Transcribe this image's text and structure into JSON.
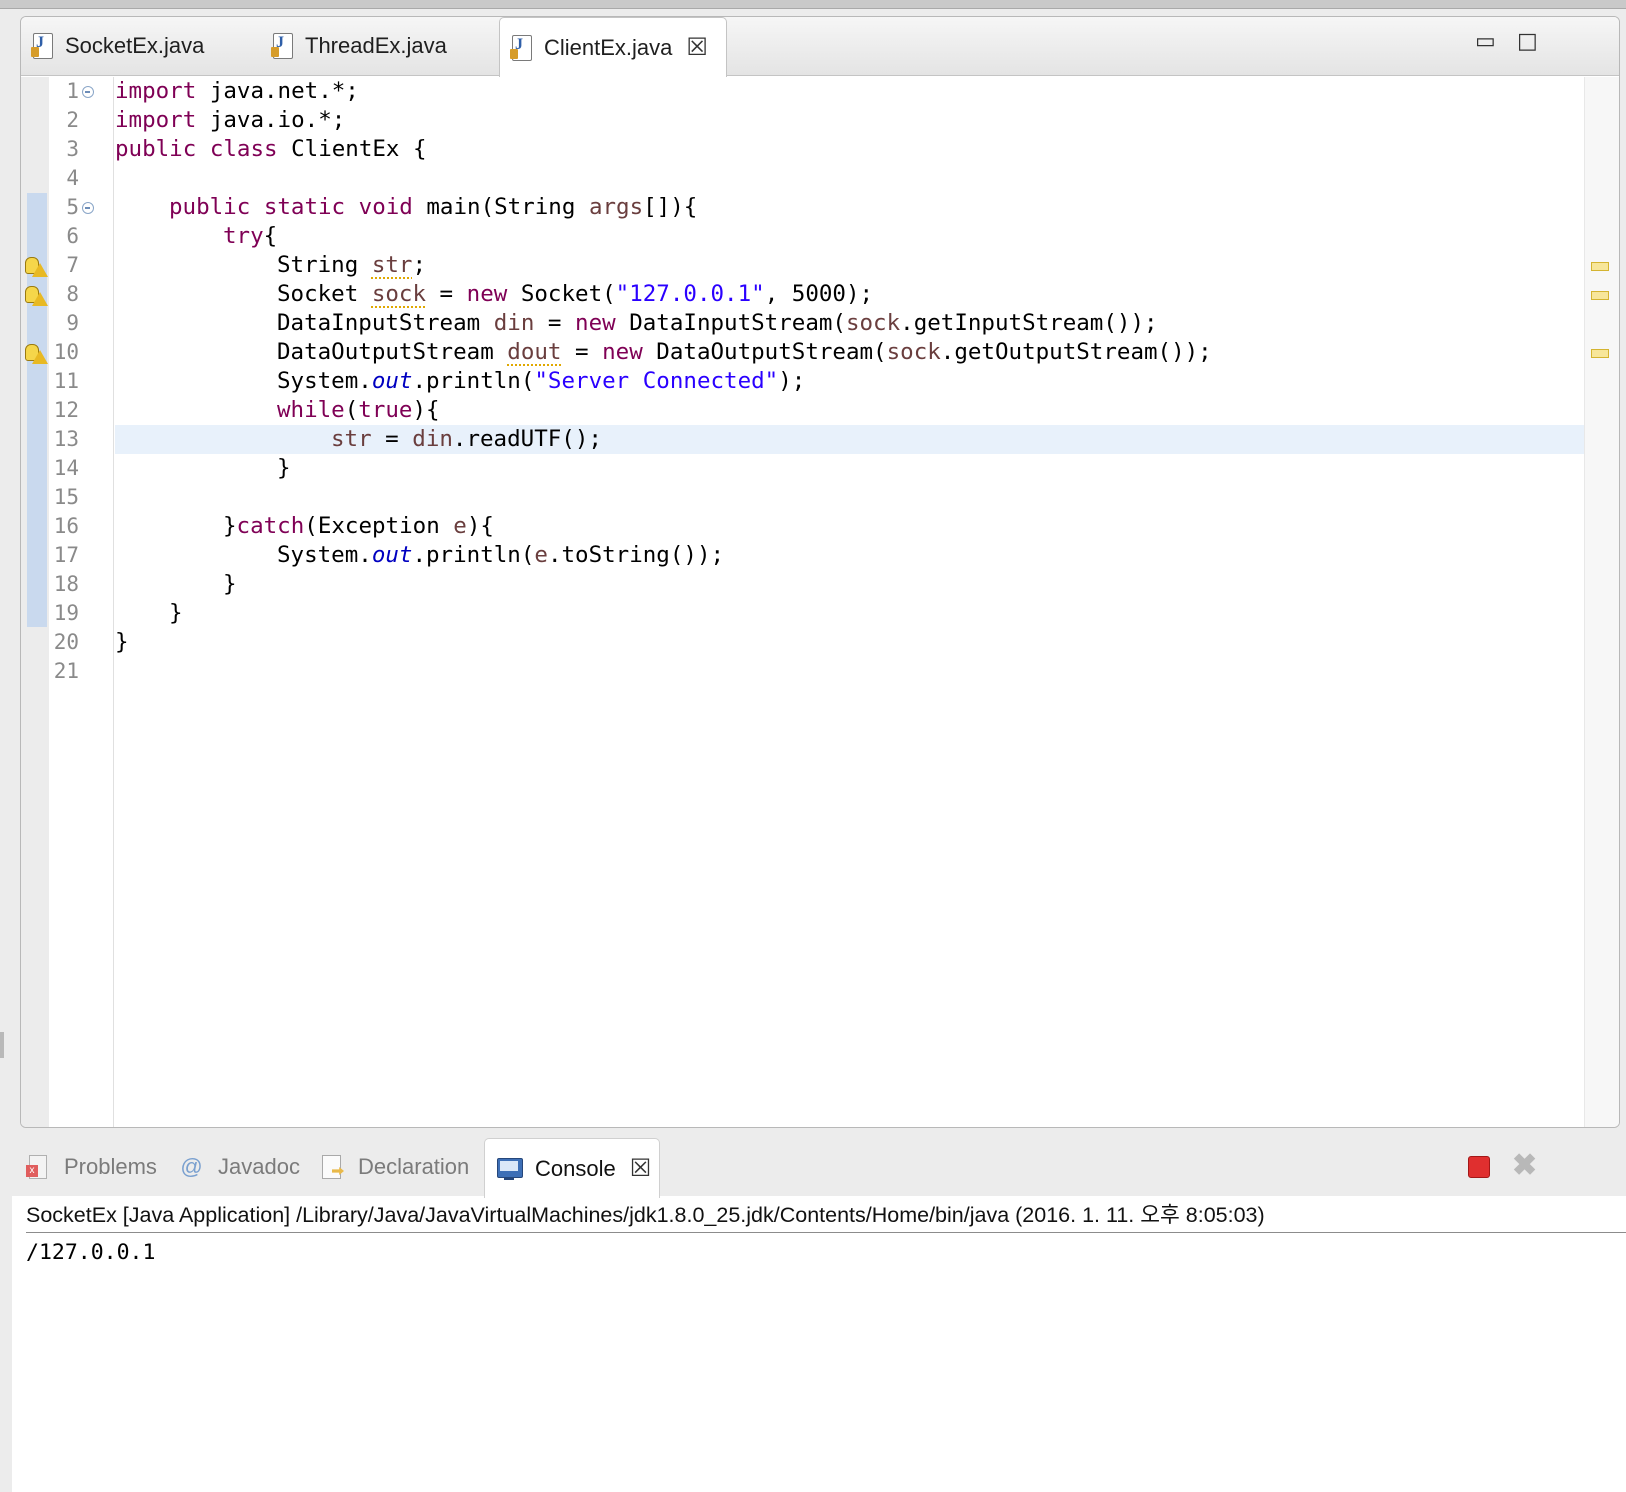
{
  "editor": {
    "tabs": [
      {
        "label": "SocketEx.java"
      },
      {
        "label": "ThreadEx.java"
      },
      {
        "label": "ClientEx.java",
        "active": true
      }
    ],
    "close_glyph": "☒",
    "minimize_glyph": "▭",
    "maximize_glyph": "□",
    "line_numbers": [
      "1",
      "2",
      "3",
      "4",
      "5",
      "6",
      "7",
      "8",
      "9",
      "10",
      "11",
      "12",
      "13",
      "14",
      "15",
      "16",
      "17",
      "18",
      "19",
      "20",
      "21"
    ],
    "current_line": 13,
    "warning_lines": [
      7,
      8,
      10
    ],
    "fold_lines": [
      1,
      5
    ],
    "code": {
      "l1_kw": "import",
      "l1_rest": " java.net.*;",
      "l2_kw": "import",
      "l2_rest": " java.io.*;",
      "l3_kw": "public class",
      "l3_rest": " ClientEx {",
      "l5_kw": "public static void",
      "l5_a": " main(String ",
      "l5_var": "args",
      "l5_b": "[]){",
      "l6_kw": "try",
      "l6_rest": "{",
      "l7_a": "String ",
      "l7_var": "str",
      "l7_b": ";",
      "l8_a": "Socket ",
      "l8_var": "sock",
      "l8_b": " = ",
      "l8_kw": "new",
      "l8_c": " Socket(",
      "l8_str": "\"127.0.0.1\"",
      "l8_d": ", 5000);",
      "l9_a": "DataInputStream ",
      "l9_var": "din",
      "l9_b": " = ",
      "l9_kw": "new",
      "l9_c": " DataInputStream(",
      "l9_var2": "sock",
      "l9_d": ".getInputStream());",
      "l10_a": "DataOutputStream ",
      "l10_var": "dout",
      "l10_b": " = ",
      "l10_kw": "new",
      "l10_c": " DataOutputStream(",
      "l10_var2": "sock",
      "l10_d": ".getOutputStream());",
      "l11_a": "System.",
      "l11_fld": "out",
      "l11_b": ".println(",
      "l11_str": "\"Server Connected\"",
      "l11_c": ");",
      "l12_kw": "while",
      "l12_a": "(",
      "l12_kw2": "true",
      "l12_b": "){",
      "l13_var": "str",
      "l13_a": " = ",
      "l13_var2": "din",
      "l13_b": ".readUTF();",
      "l14": "}",
      "l16_a": "}",
      "l16_kw": "catch",
      "l16_b": "(Exception ",
      "l16_var": "e",
      "l16_c": "){",
      "l17_a": "System.",
      "l17_fld": "out",
      "l17_b": ".println(",
      "l17_var": "e",
      "l17_c": ".toString());",
      "l18": "}",
      "l19": "}",
      "l20": "}"
    },
    "colors": {
      "keyword": "#7f0055",
      "string": "#2a00ff",
      "variable": "#6a3e3e",
      "field": "#0000c0",
      "current_line": "#e8f1fb"
    }
  },
  "panel": {
    "tabs": [
      {
        "label": "Problems"
      },
      {
        "label": "Javadoc",
        "icon": "@"
      },
      {
        "label": "Declaration"
      },
      {
        "label": "Console",
        "active": true
      }
    ],
    "close_glyph": "☒",
    "remove_glyph": "✖",
    "console_header": "SocketEx [Java Application] /Library/Java/JavaVirtualMachines/jdk1.8.0_25.jdk/Contents/Home/bin/java (2016. 1. 11. 오후 8:05:03)",
    "console_output": "/127.0.0.1",
    "stop_color": "#e02f2f"
  }
}
